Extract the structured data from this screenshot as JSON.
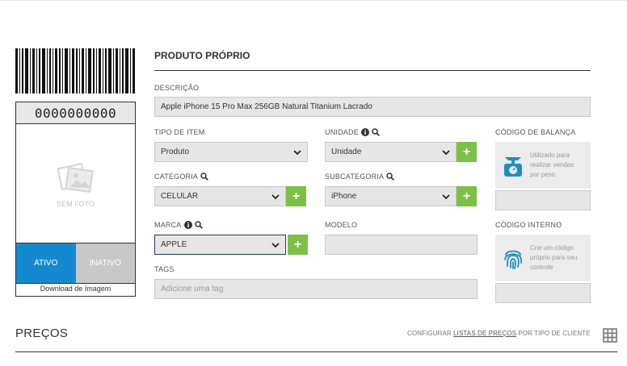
{
  "product": {
    "code": "0000000000",
    "photo_label": "SEM FOTO",
    "status_active": "ATIVO",
    "status_inactive": "INATIVO",
    "download_label": "Download de Imagem"
  },
  "form": {
    "section_title": "PRODUTO PRÓPRIO",
    "descricao_label": "DESCRIÇÃO",
    "descricao_value": "Apple iPhone 15 Pro Max 256GB Natural Titanium Lacrado",
    "tipo_label": "TIPO DE ITEM",
    "tipo_value": "Produto",
    "unidade_label": "UNIDADE",
    "unidade_value": "Unidade",
    "categoria_label": "CATEGORIA",
    "categoria_value": "CELULAR",
    "subcategoria_label": "SUBCATEGORIA",
    "subcategoria_value": "iPhone",
    "marca_label": "MARCA",
    "marca_value": "APPLE",
    "modelo_label": "MODELO",
    "modelo_value": "",
    "tags_label": "TAGS",
    "tags_placeholder": "Adicione uma tag",
    "balanca_label": "CÓDIGO DE BALANÇA",
    "balanca_hint": "Utilizado para realizar vendas por peso",
    "balanca_value": "",
    "interno_label": "CÓDIGO INTERNO",
    "interno_hint": "Crie um código próprio para seu controle",
    "interno_value": ""
  },
  "prices": {
    "title": "PREÇOS",
    "config_prefix": "CONFIGURAR ",
    "config_link": "LISTAS DE PREÇOS",
    "config_suffix": " POR TIPO DE CLIENTE"
  },
  "colors": {
    "active_blue": "#1589d0",
    "add_green": "#7cc045",
    "scale_teal": "#1d8fbf"
  }
}
